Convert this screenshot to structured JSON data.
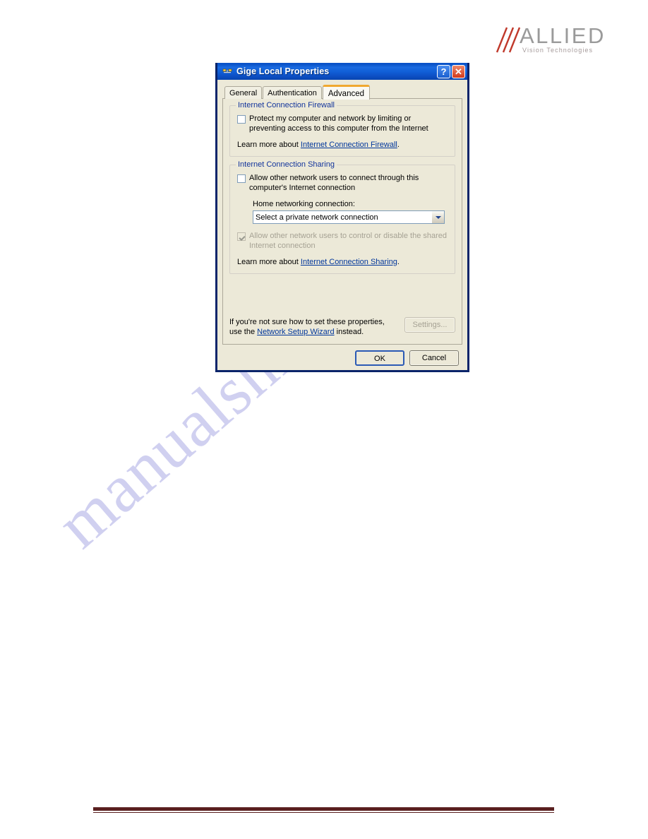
{
  "page": {
    "watermark": "manualshive.com",
    "background": "#ffffff"
  },
  "logo": {
    "word": "ALLIED",
    "subtitle": "Vision Technologies",
    "slash_color": "#c0392b",
    "word_color": "#9a9a9a"
  },
  "dialog": {
    "title": "Gige Local Properties",
    "icon": "network-connection-icon",
    "titlebar_color": "#1160d8",
    "buttons": {
      "help": "?",
      "close": "✕"
    },
    "tabs": [
      {
        "label": "General",
        "active": false
      },
      {
        "label": "Authentication",
        "active": false
      },
      {
        "label": "Advanced",
        "active": true
      }
    ],
    "firewall_group": {
      "title": "Internet Connection Firewall",
      "checkbox": {
        "label": "Protect my computer and network by limiting or preventing access to this computer from the Internet",
        "checked": false,
        "disabled": false
      },
      "learn_prefix": "Learn more about ",
      "learn_link": "Internet Connection Firewall",
      "learn_suffix": "."
    },
    "sharing_group": {
      "title": "Internet Connection Sharing",
      "allow_connect": {
        "label": "Allow other network users to connect through this computer's Internet connection",
        "checked": false,
        "disabled": false
      },
      "home_network_label": "Home networking connection:",
      "combo_value": "Select a private network connection",
      "allow_control": {
        "label": "Allow other network users to control or disable the shared Internet connection",
        "checked": true,
        "disabled": true
      },
      "learn_prefix": "Learn more about ",
      "learn_link": "Internet Connection Sharing",
      "learn_suffix": "."
    },
    "hint": {
      "prefix": "If you're not sure how to set these properties, use the ",
      "link": "Network Setup Wizard",
      "suffix": " instead."
    },
    "settings_button": {
      "label": "Settings...",
      "disabled": true
    },
    "ok_button": "OK",
    "cancel_button": "Cancel"
  },
  "footer": {
    "rule_color": "#5a2020"
  }
}
